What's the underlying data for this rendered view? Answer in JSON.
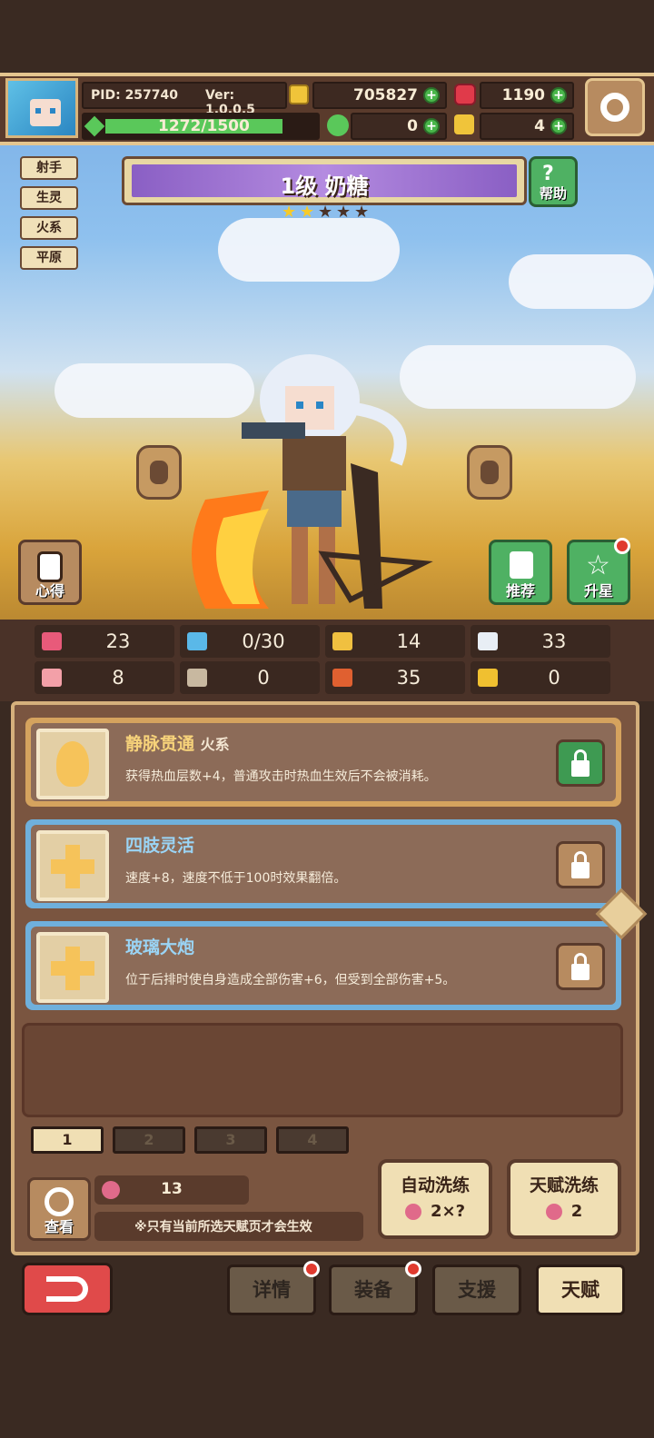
{
  "topbar": {
    "pid": "PID: 257740",
    "version": "Ver: 1.0.0.5",
    "gold": "705827",
    "gems": "1190",
    "clover": "0",
    "keys": "4",
    "xp_text": "1272/1500",
    "xp_progress": 0.848
  },
  "tags": [
    "射手",
    "生灵",
    "火系",
    "平原"
  ],
  "hero": {
    "level_name": "1级 奶糖",
    "stars_filled": 2,
    "stars_total": 5
  },
  "buttons": {
    "help": "帮助",
    "insight": "心得",
    "recommend": "推荐",
    "star_up": "升星"
  },
  "stats": [
    {
      "icon": "heart-icon",
      "value": "23",
      "color": "#e85a7a"
    },
    {
      "icon": "mana-drop-icon",
      "value": "0/30",
      "color": "#5ab8e8"
    },
    {
      "icon": "shield-icon",
      "value": "14",
      "color": "#f0c040"
    },
    {
      "icon": "speed-wing-icon",
      "value": "33",
      "color": "#e8eef5"
    },
    {
      "icon": "fist-icon",
      "value": "8",
      "color": "#f3a0a8"
    },
    {
      "icon": "book-icon",
      "value": "0",
      "color": "#c8b8a0"
    },
    {
      "icon": "crit-icon",
      "value": "35",
      "color": "#e06030"
    },
    {
      "icon": "horseshoe-icon",
      "value": "0",
      "color": "#f0c030"
    }
  ],
  "talents": [
    {
      "title": "静脉贯通",
      "subtitle": "火系",
      "desc": "获得热血层数+4，普通攻击时热血生效后不会被消耗。",
      "locked": true
    },
    {
      "title": "四肢灵活",
      "subtitle": "",
      "desc": "速度+8，速度不低于100时效果翻倍。",
      "locked": false
    },
    {
      "title": "玻璃大炮",
      "subtitle": "",
      "desc": "位于后排时使自身造成全部伤害+6，但受到全部伤害+5。",
      "locked": false
    }
  ],
  "pages": [
    "1",
    "2",
    "3",
    "4"
  ],
  "bottom": {
    "view": "查看",
    "fruit_count": "13",
    "note": "※只有当前所选天赋页才会生效",
    "auto_refine": "自动洗练",
    "auto_cost": "2×?",
    "talent_refine": "天赋洗练",
    "talent_cost": "2"
  },
  "nav": {
    "details": "详情",
    "equip": "装备",
    "support": "支援",
    "talent": "天赋"
  },
  "colors": {
    "wood": "#7a5540",
    "trim": "#d5b07c",
    "accent_purple": "#8a5fc4",
    "active_tab": "#f0dfb4"
  }
}
